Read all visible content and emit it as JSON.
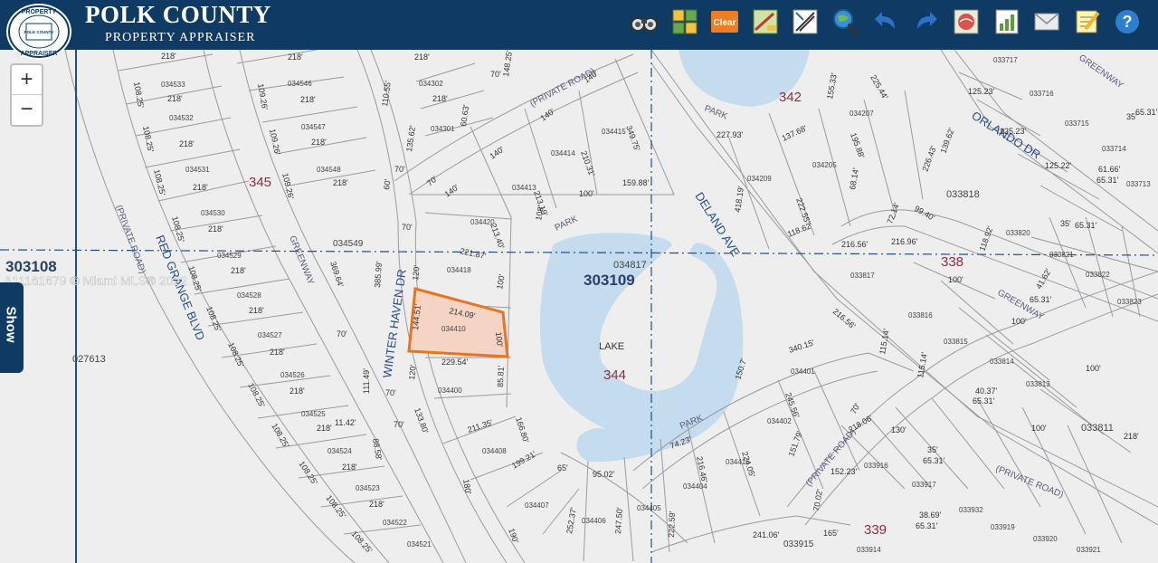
{
  "header": {
    "title": "POLK COUNTY",
    "subtitle": "PROPERTY APPRAISER",
    "seal_top": "PROPERTY",
    "seal_center": "POLK COUNTY",
    "seal_bottom": "APPRAISER"
  },
  "toolbar": {
    "clear_label": "Clear"
  },
  "zoom": {
    "in_label": "+",
    "out_label": "−"
  },
  "panel": {
    "show_label": "Show"
  },
  "watermark": "A11161679 © Miami MLS® 2022",
  "colors": {
    "header": "#0e3a63",
    "parcel_fill": "#f6d4c3",
    "parcel_stroke": "#e8741f",
    "lake": "#c5dbee",
    "label_blue": "#2a4d8c",
    "block": "#8d2e3e"
  },
  "map": {
    "sections": [
      "303108",
      "303109"
    ],
    "blocks": [
      "345",
      "342",
      "338",
      "344",
      "339"
    ],
    "streets": {
      "winter_haven": "WINTER HAVEN DR",
      "red_grange": "RED GRANGE BLVD",
      "deland": "DELAND AVE",
      "orlando": "ORLANDO DR",
      "private": "(PRIVATE ROAD)",
      "greenway": "GREENWAY",
      "park": "PARK",
      "lake": "LAKE"
    },
    "parcels": {
      "p034410": "034410",
      "p034418": "034418",
      "p034400": "034400",
      "p034420": "034420",
      "p034413": "034413",
      "p034414": "034414",
      "p034415": "034415",
      "p034549": "034549",
      "p034817": "034817",
      "p033818": "033818",
      "p027613": "027613",
      "p033811": "033811",
      "p034533": "034533",
      "p034532": "034532",
      "p034531": "034531",
      "p034530": "034530",
      "p034529": "034529",
      "p034528": "034528",
      "p034527": "034527",
      "p034526": "034526",
      "p034525": "034525",
      "p034524": "034524",
      "p034523": "034523",
      "p034522": "034522",
      "p034521": "034521",
      "p034546": "034546",
      "p034547": "034547",
      "p034548": "034548",
      "p034302": "034302",
      "p034301": "034301",
      "p034209": "034209",
      "p034205": "034205",
      "p034207": "034207",
      "p034401": "034401",
      "p034402": "034402",
      "p034416": "034416",
      "p034404": "034404",
      "p034405": "034405",
      "p034406": "034406",
      "p034407": "034407",
      "p034408": "034408",
      "p033915": "033915",
      "p033914": "033914",
      "p033916": "033916",
      "p033917": "033917",
      "p033932": "033932",
      "p033919": "033919",
      "p033920": "033920",
      "p033921": "033921",
      "p033717": "033717",
      "p033716": "033716",
      "p033715": "033715",
      "p033714": "033714",
      "p033713": "033713",
      "p033820": "033820",
      "p033821": "033821",
      "p033822": "033822",
      "p033823": "033823",
      "p033817": "033817",
      "p033816": "033816",
      "p033815": "033815",
      "p033814": "033814",
      "p033813": "033813"
    },
    "dims": {
      "d21409": "214.09'",
      "d14451": "144.51'",
      "d100": "100'",
      "d22954": "229.54'",
      "d21187": "221.87'",
      "d8581": "85.81'",
      "d120": "120'",
      "d70": "70'",
      "d21340": "213.40'",
      "d108": "108'",
      "d21319": "213.19'",
      "d21031": "210.31'",
      "d34975": "349.75'",
      "d15988": "159.88'",
      "d140": "140'",
      "d218": "218'",
      "d10825": "108.25'",
      "d10926": "109.26'",
      "d38599": "385.99'",
      "d36964": "369.64'",
      "d11149": "111.49'",
      "d21135": "211.35'",
      "d16680": "166.80'",
      "d9502": "95.02'",
      "d19921": "199.21'",
      "d25237": "252.37'",
      "d24750": "247.50'",
      "d22259": "222.59'",
      "d7423": "74.23'",
      "d21646": "216.46'",
      "d22405": "224.05'",
      "d1507": "150.7'",
      "d24556": "245.56'",
      "d15179": "151.79'",
      "d34015": "340.15'",
      "d22793": "227.93'",
      "d41819": "418.19'",
      "d13768": "137.68'",
      "d22255": "222.55'",
      "d11862": "118.62'",
      "d19588": "195.88'",
      "d15533": "155.33'",
      "d22544": "225.44'",
      "d6814": "68.14'",
      "d13962": "139.62'",
      "d22643": "226.43'",
      "d9940": "99.40'",
      "d7214": "72.14'",
      "d11862b": "118.92'",
      "d4162": "41.62'",
      "d6531": "65.31'",
      "d12523": "125.23'",
      "d12522": "125.22'",
      "d6166": "61.66'",
      "d35": "35'",
      "d21096": "216.96'",
      "d21656": "216.56'",
      "d11514": "115.14'",
      "d4037": "40.37'",
      "d21806": "218.06'",
      "d15223": "152.23'",
      "d7002": "70.02'",
      "d3869": "38.69'",
      "d24106": "241.06'",
      "d165": "165'",
      "d130": "130'",
      "d1142": "11.42'",
      "d8858": "88.58'",
      "d10955": "110.55'",
      "d13562": "135.62'",
      "d6063": "60.63'",
      "d1005": "148.25'",
      "d60": "60'",
      "d180": "180'",
      "d190": "190'",
      "d65": "65'",
      "d133": "133.80'"
    }
  }
}
